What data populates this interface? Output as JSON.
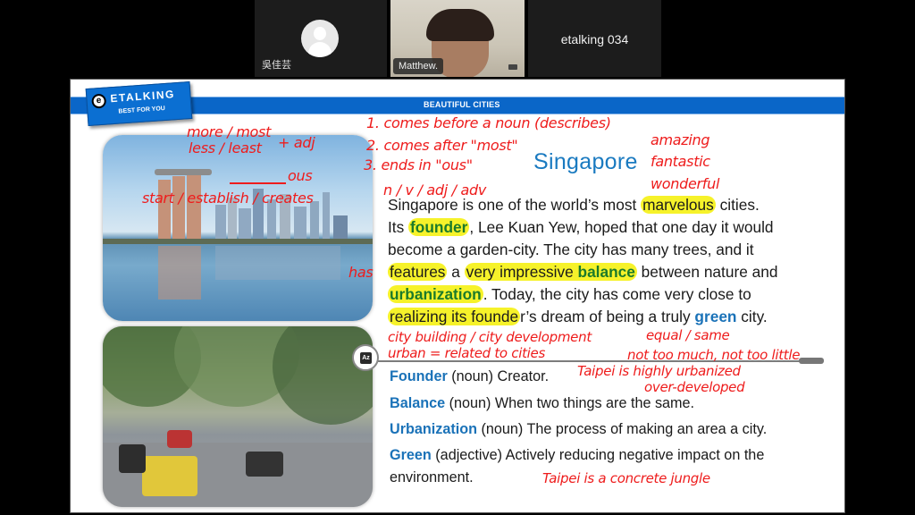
{
  "meeting": {
    "participants": [
      {
        "name": "吳佳芸",
        "video": false,
        "avatar": "default-person-icon"
      },
      {
        "name": "Matthew.",
        "video": true
      },
      {
        "name": "etalking 034",
        "video": false,
        "display": "name-only"
      }
    ]
  },
  "slide": {
    "logo": {
      "brand": "ETALKING",
      "tagline": "BEST FOR YOU"
    },
    "title_bar": "BEAUTIFUL CITIES",
    "heading": "Singapore",
    "paragraph": {
      "l1_a": "Singapore is one of the world’s most ",
      "l1_hl": "marvelous",
      "l1_b": " cities.",
      "l2_a": "Its ",
      "l2_kw": "founder",
      "l2_b": ", Lee Kuan Yew, hoped that one day it would",
      "l3": "become a garden-city. The city has many trees, and it",
      "l4_hl1": "features",
      "l4_a": " a ",
      "l4_hl2": "very impressive ",
      "l4_kw": "balance",
      "l4_b": " between nature and",
      "l5_kw": "urbanization",
      "l5_b": ". Today, the city has come very close to",
      "l6_hl": "realizing its founde",
      "l6_a": "r’s dream of being a truly ",
      "l6_kw": "green",
      "l6_b": " city."
    },
    "glossary": [
      {
        "term": "Founder",
        "pos": " (noun) ",
        "def": "Creator."
      },
      {
        "term": "Balance",
        "pos": " (noun) ",
        "def": "When two things are the same."
      },
      {
        "term": "Urbanization",
        "pos": " (noun) ",
        "def": "The process of making an area a city."
      },
      {
        "term": "Green",
        "pos": " (adjective) ",
        "def": "Actively reducing negative impact on the",
        "def_cont": "environment."
      }
    ],
    "pointer_label": "Matthew.",
    "dictionary_button_icon": "a-z-dictionary-icon",
    "annotations": {
      "more_most": "more / most",
      "less_least": "less / least",
      "plus_adj": "+ adj",
      "ous_blank": "ous",
      "start_establish": "start / establish / creates",
      "rule1": "1. comes before a noun (describes)",
      "rule2": "2. comes after \"most\"",
      "rule3": "3.   ends in \"ous\"",
      "parts_of_speech": "n / v / adj / adv",
      "amazing": "amazing",
      "fantastic": "fantastic",
      "wonderful": "wonderful",
      "has": "has",
      "city_building": "city building / city development",
      "urban": "urban = related to cities",
      "equal_same": "equal / same",
      "not_too_much": "not too much, not too little",
      "taipei_urbanized": "Taipei is highly urbanized",
      "over_developed": "over-developed",
      "concrete_jungle": "Taipei is a concrete jungle"
    }
  }
}
